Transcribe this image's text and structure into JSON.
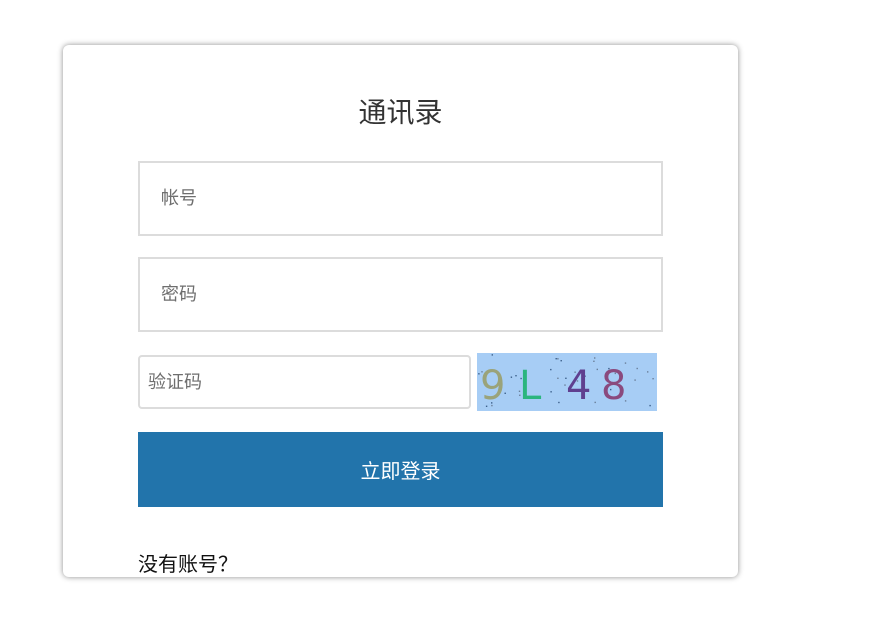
{
  "login": {
    "title": "通讯录",
    "account_placeholder": "帐号",
    "password_placeholder": "密码",
    "captcha_placeholder": "验证码",
    "captcha_text": [
      "9",
      "L",
      "4",
      "8"
    ],
    "captcha_colors": [
      "#9aa37a",
      "#2bb57e",
      "#5f3f8f",
      "#8a4a7e"
    ],
    "captcha_background": "#a7cdf5",
    "submit_label": "立即登录",
    "register_link": "没有账号？"
  },
  "colors": {
    "primary_button": "#2274ab",
    "input_border": "#dcdcdc"
  }
}
